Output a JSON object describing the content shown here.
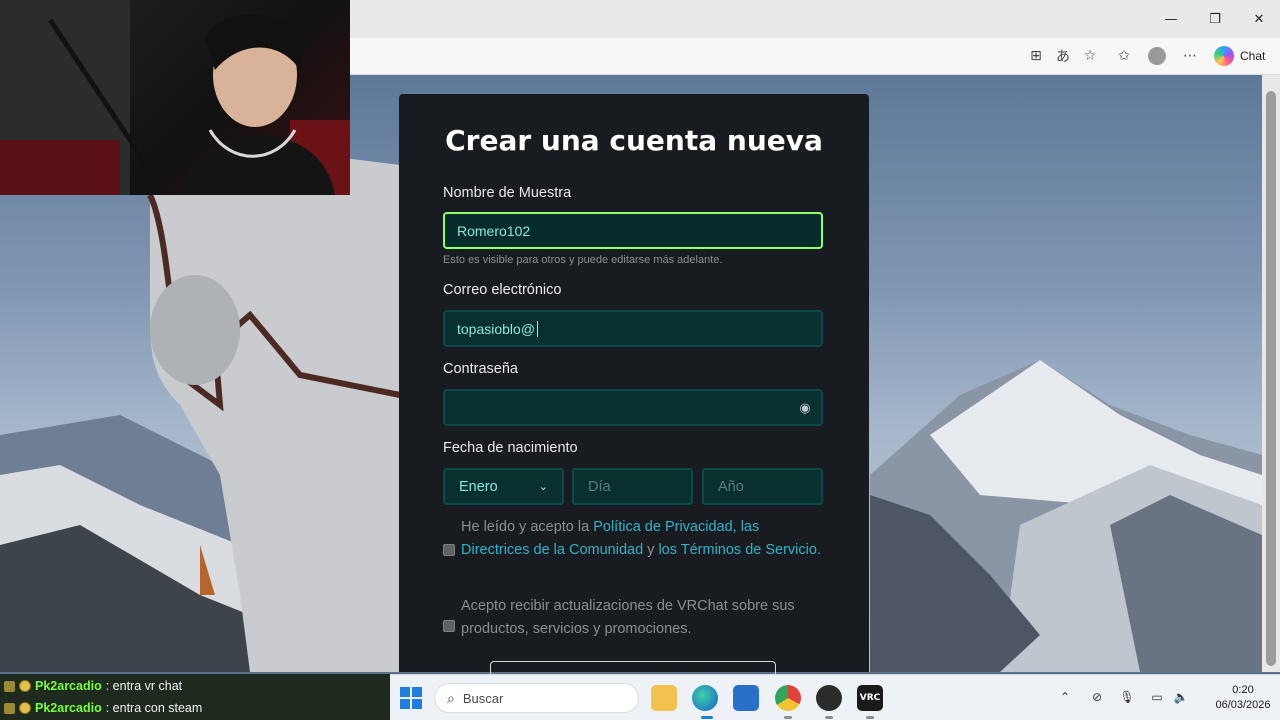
{
  "browser": {
    "toolbar_chat_label": "Chat"
  },
  "form": {
    "title": "Crear una cuenta nueva",
    "display_name": {
      "label": "Nombre de Muestra",
      "value": "Romero102",
      "hint": "Esto es visible para otros y puede editarse más adelante."
    },
    "email": {
      "label": "Correo electrónico",
      "value": "topasioblo@"
    },
    "password": {
      "label": "Contraseña",
      "value": ""
    },
    "birthdate": {
      "label": "Fecha de nacimiento",
      "month_value": "Enero",
      "day_placeholder": "Día",
      "year_placeholder": "Año"
    },
    "terms": {
      "text_before": "He leído y acepto la ",
      "privacy_link": "Política de Privacidad,",
      "community_link": "las Directrices de la Comunidad",
      "text_and": " y ",
      "tos_link": "los Términos de Servicio.",
      "checked": false
    },
    "updates": {
      "text": "Acepto recibir actualizaciones de VRChat sobre sus productos, servicios y promociones.",
      "checked": false
    }
  },
  "stream_chat": [
    {
      "user": "Pk2arcadio",
      "message": ": entra vr chat"
    },
    {
      "user": "Pk2arcadio",
      "message": ": entra con steam"
    }
  ],
  "taskbar": {
    "search_label": "Buscar",
    "time": "0:20",
    "date": "06/03/2026",
    "apps": [
      "file-explorer",
      "edge",
      "store",
      "chrome",
      "obs",
      "vrchat"
    ]
  }
}
